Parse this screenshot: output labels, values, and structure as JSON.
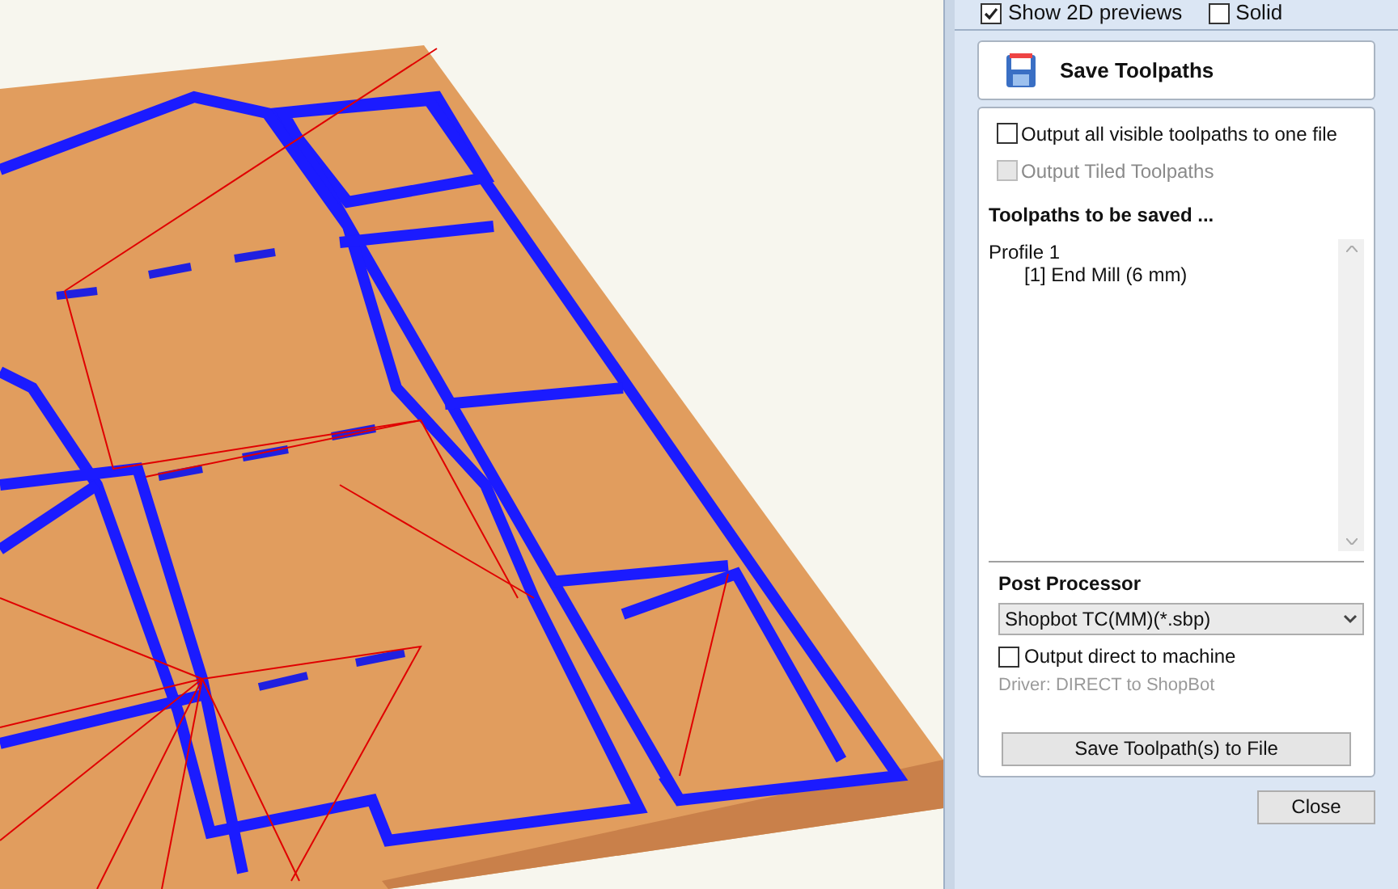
{
  "view_options": [
    {
      "label": "Show 2D previews",
      "checked": true
    },
    {
      "label": "Solid",
      "checked": false
    }
  ],
  "header": {
    "title": "Save Toolpaths"
  },
  "options": [
    {
      "label": "Output all visible toolpaths to one file",
      "checked": false,
      "disabled": false
    },
    {
      "label": "Output Tiled Toolpaths",
      "checked": false,
      "disabled": true
    }
  ],
  "toolpaths": {
    "heading": "Toolpaths to be saved ...",
    "items": [
      {
        "label": "Profile 1",
        "children": [
          {
            "label": "[1] End Mill (6 mm)"
          }
        ]
      }
    ]
  },
  "post_processor": {
    "heading": "Post Processor",
    "value": "Shopbot TC(MM)(*.sbp)",
    "direct": {
      "label": "Output direct to machine",
      "checked": false
    },
    "driver": "Driver: DIRECT to ShopBot",
    "save_button": "Save Toolpath(s) to File"
  },
  "close_button": "Close"
}
